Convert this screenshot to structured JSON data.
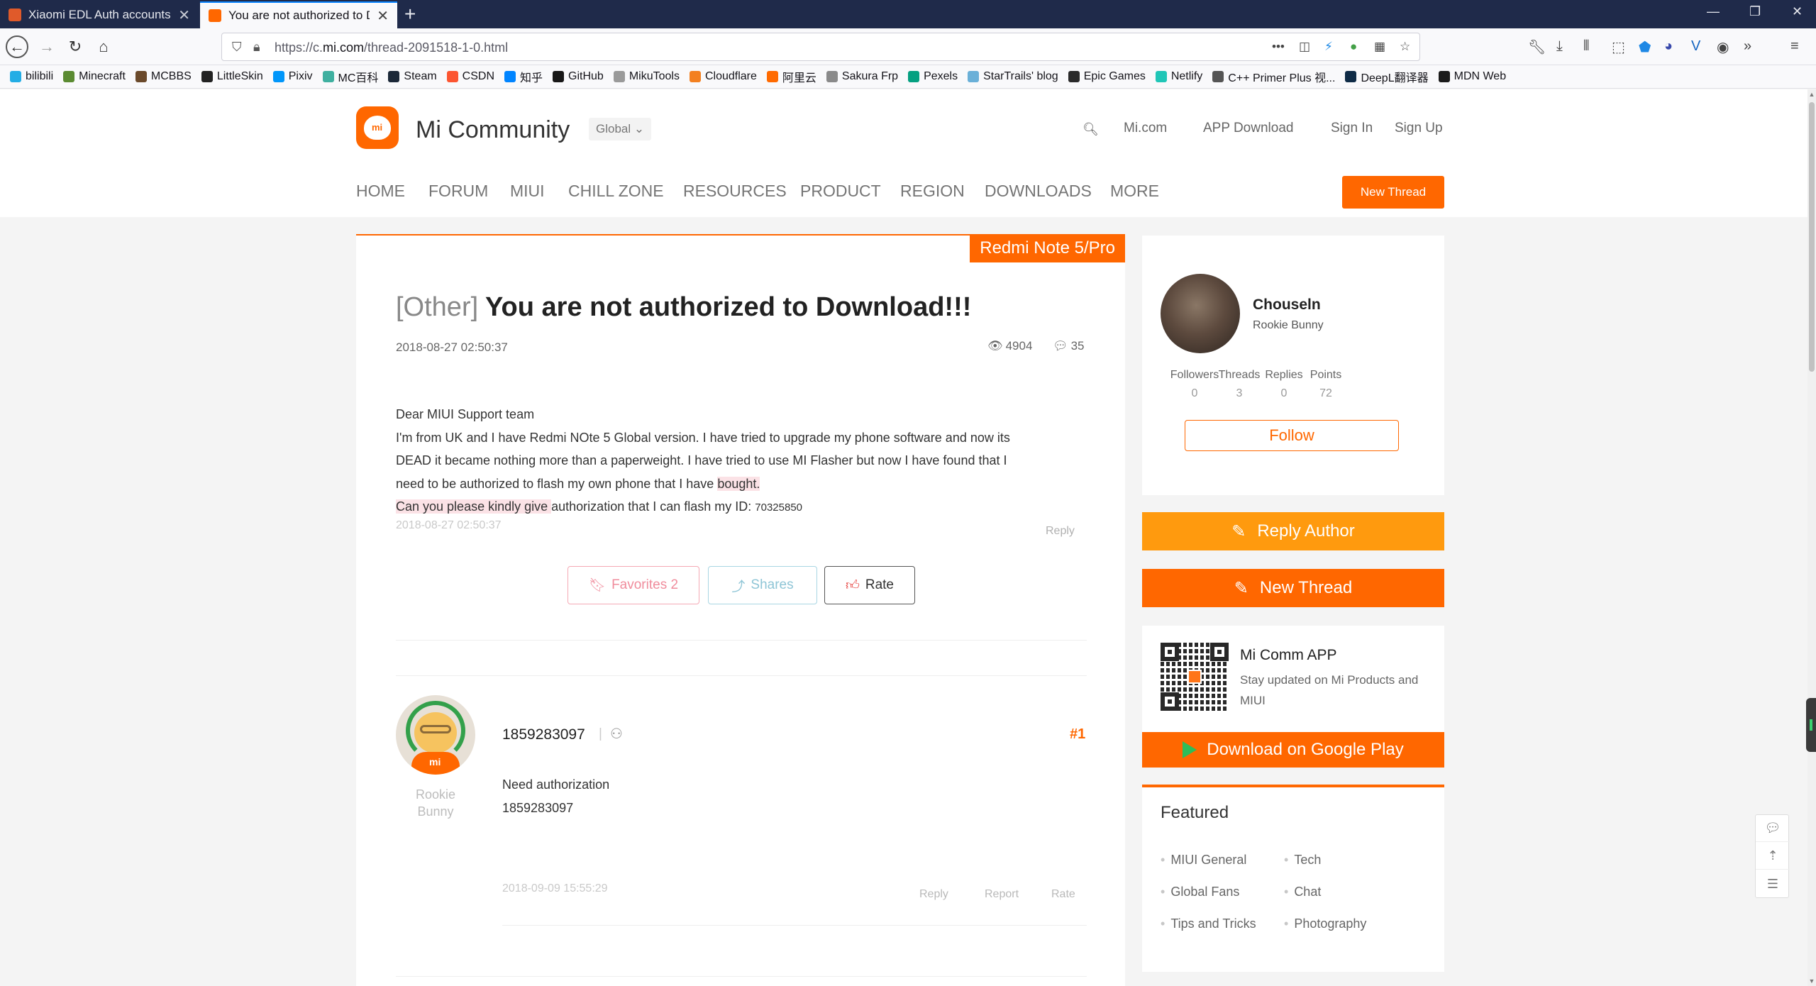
{
  "browser": {
    "tabs": [
      {
        "title": "Xiaomi EDL Auth accounts | ",
        "active": false
      },
      {
        "title": "You are not authorized to Do",
        "active": true
      }
    ],
    "url": {
      "prefix": "https://c.",
      "domain": "mi.com",
      "path": "/thread-2091518-1-0.html"
    },
    "bookmarks": [
      {
        "label": "bilibili",
        "color": "#23ade5"
      },
      {
        "label": "Minecraft",
        "color": "#5b8b32"
      },
      {
        "label": "MCBBS",
        "color": "#6b4a2b"
      },
      {
        "label": "LittleSkin",
        "color": "#222222"
      },
      {
        "label": "Pixiv",
        "color": "#0096fa"
      },
      {
        "label": "MC百科",
        "color": "#3fb0a0"
      },
      {
        "label": "Steam",
        "color": "#1b2838"
      },
      {
        "label": "CSDN",
        "color": "#fc5531"
      },
      {
        "label": "知乎",
        "color": "#0084ff"
      },
      {
        "label": "GitHub",
        "color": "#181717"
      },
      {
        "label": "MikuTools",
        "color": "#9a9a9a"
      },
      {
        "label": "Cloudflare",
        "color": "#f38020"
      },
      {
        "label": "阿里云",
        "color": "#ff6a00"
      },
      {
        "label": "Sakura Frp",
        "color": "#8a8a8a"
      },
      {
        "label": "Pexels",
        "color": "#05a081"
      },
      {
        "label": "StarTrails' blog",
        "color": "#6ab0d8"
      },
      {
        "label": "Epic Games",
        "color": "#2a2a2a"
      },
      {
        "label": "Netlify",
        "color": "#20c6b7"
      },
      {
        "label": "C++ Primer Plus 视...",
        "color": "#555555"
      },
      {
        "label": "DeepL翻译器",
        "color": "#0f2b46"
      },
      {
        "label": "MDN Web",
        "color": "#1b1b1b"
      }
    ]
  },
  "header": {
    "site_title": "Mi Community",
    "region": "Global",
    "links": {
      "mi_com": "Mi.com",
      "app_download": "APP Download",
      "sign_in": "Sign In",
      "sign_up": "Sign Up"
    },
    "nav": [
      "HOME",
      "FORUM",
      "MIUI",
      "CHILL ZONE",
      "RESOURCES",
      "PRODUCT",
      "REGION",
      "DOWNLOADS",
      "MORE"
    ],
    "new_thread": "New Thread"
  },
  "post": {
    "device_tag": "Redmi Note 5/Pro",
    "category": "[Other]",
    "title": "You are not authorized to Download!!!",
    "date": "2018-08-27 02:50:37",
    "views": "4904",
    "comments": "35",
    "body": {
      "line1": "Dear MIUI Support team",
      "line2": "I'm from UK and I have Redmi NOte 5 Global version. I have tried to upgrade my phone software and now its",
      "line3": "DEAD it became nothing more than a paperweight. I have tried to use MI Flasher but now I have found that I",
      "line4_a": "need to be authorized to flash my own phone that I have ",
      "line4_hl": "bought.",
      "line5_hl": "Can you please kindly give ",
      "line5_b": "authorization that I can flash my ID: ",
      "line5_id": "70325850"
    },
    "body_date": "2018-08-27 02:50:37",
    "reply_label": "Reply",
    "actions": {
      "favorites": "Favorites 2",
      "shares": "Shares",
      "rate": "Rate"
    }
  },
  "reply": {
    "user": "1859283097",
    "rank": "Rookie Bunny",
    "floor": "#1",
    "body": [
      "Need authorization",
      "1859283097"
    ],
    "date": "2018-09-09 15:55:29",
    "actions": [
      "Reply",
      "Report",
      "Rate"
    ]
  },
  "sidebar": {
    "author": {
      "name": "Chouseln",
      "rank": "Rookie Bunny"
    },
    "stats": [
      {
        "label": "Followers",
        "value": "0"
      },
      {
        "label": "Threads",
        "value": "3"
      },
      {
        "label": "Replies",
        "value": "0"
      },
      {
        "label": "Points",
        "value": "72"
      }
    ],
    "follow": "Follow",
    "reply_author": "Reply Author",
    "new_thread": "New Thread",
    "app": {
      "title": "Mi Comm APP",
      "desc": "Stay updated on Mi Products and MIUI",
      "google_play": "Download on Google Play"
    },
    "featured": {
      "title": "Featured",
      "items": [
        "MIUI General",
        "Tech",
        "Global Fans",
        "Chat",
        "Tips and Tricks",
        "Photography"
      ]
    }
  },
  "colors": {
    "accent": "#ff6700",
    "accent_light": "#ff9a0e"
  }
}
